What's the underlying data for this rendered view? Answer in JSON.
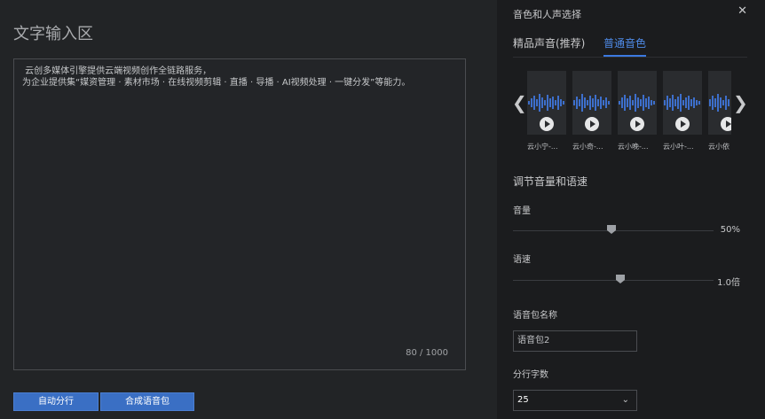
{
  "left": {
    "title": "文字输入区",
    "text_lines": [
      " 云创多媒体引擎提供云端视频创作全链路服务，",
      "为企业提供集“媒资管理 · 素材市场 · 在线视频剪辑 · 直播 · 导播 · AI视频处理 · 一键分发”等能力。"
    ],
    "counter": "80 / 1000",
    "buttons": {
      "auto_wrap": "自动分行",
      "synthesize": "合成语音包"
    }
  },
  "right": {
    "panel_title": "音色和人声选择",
    "tabs": [
      "精品声音(推荐)",
      "普通音色"
    ],
    "active_tab": "普通音色",
    "voices": [
      "云小宁-...",
      "云小奇-...",
      "云小晚-...",
      "云小叶-...",
      "云小依"
    ],
    "section_title": "调节音量和语速",
    "volume": {
      "label": "音量",
      "value_text": "50%",
      "level": 0.5
    },
    "speed": {
      "label": "语速",
      "value_text": "1.0倍",
      "level": 0.5
    },
    "package_name": {
      "label": "语音包名称",
      "value": "语音包2"
    },
    "chars_per_line": {
      "label": "分行字数",
      "value": "25"
    },
    "colors": {
      "accent": "#3a6fc4",
      "tab_active": "#4f8be8",
      "wave": "#3d6fcc"
    },
    "icons": {
      "close": "close-icon",
      "prev": "chevron-left-icon",
      "next": "chevron-right-icon",
      "play": "play-icon",
      "dropdown": "chevron-down-icon"
    }
  }
}
